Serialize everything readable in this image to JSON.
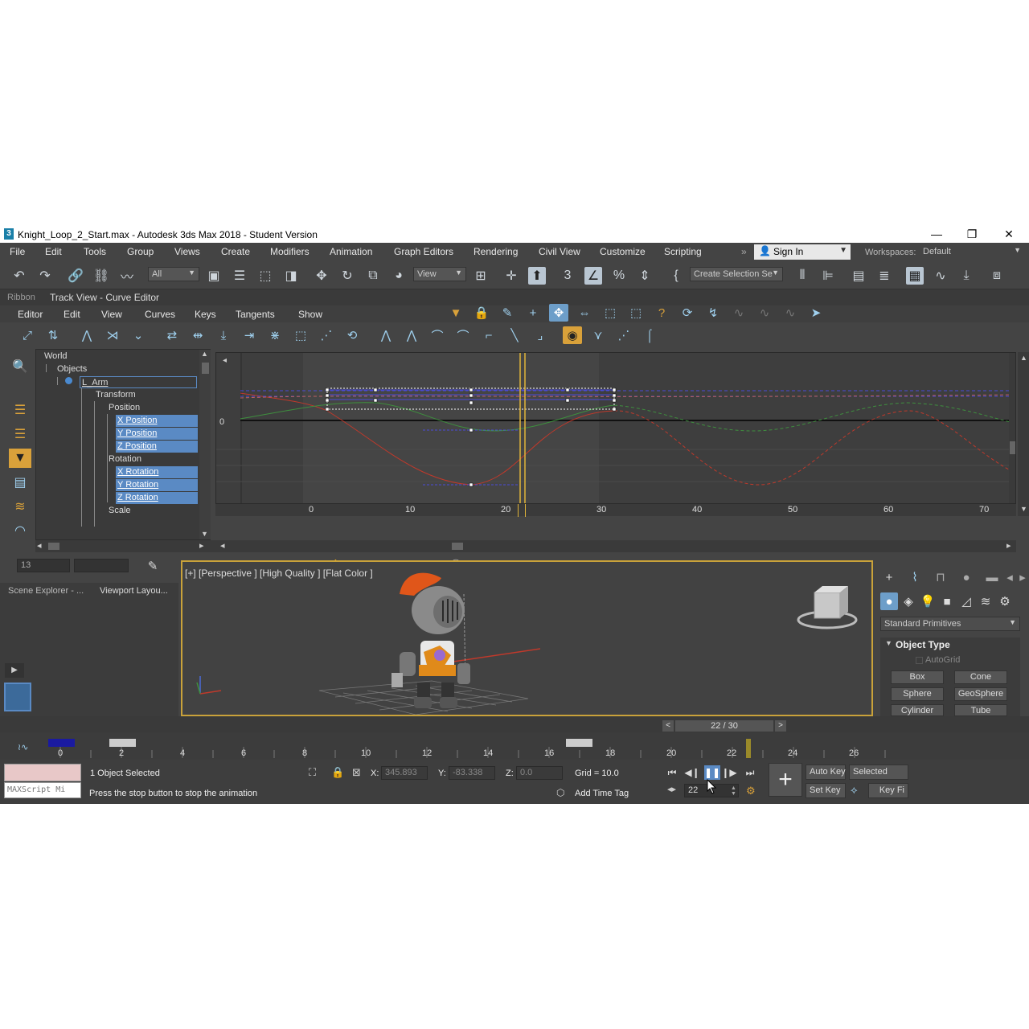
{
  "window": {
    "title": "Knight_Loop_2_Start.max - Autodesk 3ds Max 2018 - Student Version",
    "minimize": "—",
    "maximize": "❐",
    "close": "✕"
  },
  "menu": [
    "File",
    "Edit",
    "Tools",
    "Group",
    "Views",
    "Create",
    "Modifiers",
    "Animation",
    "Graph Editors",
    "Rendering",
    "Civil View",
    "Customize",
    "Scripting"
  ],
  "signin": {
    "label": "Sign In"
  },
  "workspaces": {
    "label": "Workspaces:",
    "value": "Default"
  },
  "toolbar": {
    "filter_value": "All",
    "refcoord_value": "View",
    "selection_set_placeholder": "Create Selection Se"
  },
  "ribbon": {
    "label": "Ribbon"
  },
  "trackview": {
    "title": "Track View - Curve Editor",
    "menu": [
      "Editor",
      "Edit",
      "View",
      "Curves",
      "Keys",
      "Tangents",
      "Show"
    ]
  },
  "tree": {
    "world": "World",
    "objects": "Objects",
    "l_arm": "L_Arm",
    "transform": "Transform",
    "position": "Position",
    "x_position": "X Position",
    "y_position": "Y Position",
    "z_position": "Z Position",
    "rotation": "Rotation",
    "x_rotation": "X Rotation",
    "y_rotation": "Y Rotation",
    "z_rotation": "Z Rotation",
    "scale": "Scale"
  },
  "graph": {
    "zero_label": "0",
    "ruler": [
      "0",
      "10",
      "20",
      "30",
      "40",
      "50",
      "60",
      "70"
    ],
    "current_frame": 22
  },
  "bottomtools": {
    "frame_field": "13"
  },
  "sidepanel": {
    "tab_scene_explorer": "Scene Explorer - ...",
    "tab_viewport_layout": "Viewport Layou..."
  },
  "viewport": {
    "label": "[+] [Perspective ] [High Quality ] [Flat Color ]"
  },
  "command_panel": {
    "category": "Standard Primitives",
    "rollout_title": "Object Type",
    "autogrid": "AutoGrid",
    "buttons": [
      "Box",
      "Cone",
      "Sphere",
      "GeoSphere",
      "Cylinder",
      "Tube"
    ]
  },
  "timeslider": {
    "label": "22 / 30",
    "prev": "<",
    "next": ">"
  },
  "timeline": {
    "ticks": [
      "0",
      "2",
      "4",
      "6",
      "8",
      "10",
      "12",
      "14",
      "16",
      "18",
      "20",
      "22",
      "24",
      "26"
    ]
  },
  "status": {
    "maxscript": "MAXScript Mi",
    "selection": "1 Object Selected",
    "prompt": "Press the stop button to stop the animation",
    "x_label": "X:",
    "x_value": "345.893",
    "y_label": "Y:",
    "y_value": "-83.338",
    "z_label": "Z:",
    "z_value": "0.0",
    "grid": "Grid = 10.0",
    "add_time_tag": "Add Time Tag",
    "current_frame": "22",
    "auto_key": "Auto Key",
    "selected": "Selected",
    "set_key": "Set Key",
    "key_filters": "Key Fi"
  },
  "colors": {
    "accent_orange": "#d9a13a",
    "selection_blue": "#5a8ac4",
    "curve_red": "#c0392b",
    "curve_green": "#4fa64f",
    "curve_blue": "#4a4ad8",
    "time_marker": "#e0b43a"
  }
}
